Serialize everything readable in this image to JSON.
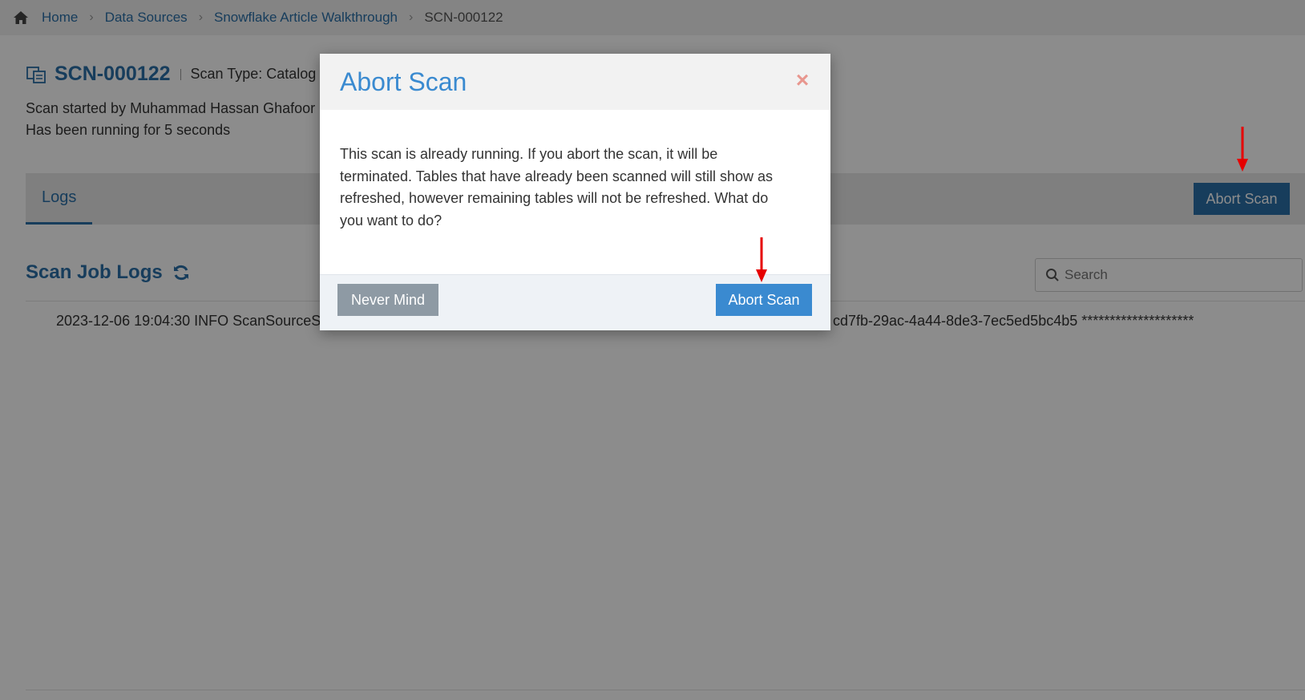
{
  "breadcrumb": {
    "home": "Home",
    "data_sources": "Data Sources",
    "walkthrough": "Snowflake Article Walkthrough",
    "current": "SCN-000122"
  },
  "scan": {
    "id": "SCN-000122",
    "type": "Scan Type: Catalog &",
    "started_by": "Scan started by Muhammad Hassan Ghafoor",
    "running": "Has been running for 5 seconds"
  },
  "tabs": {
    "logs": "Logs",
    "abort_label": "Abort Scan"
  },
  "logs": {
    "title": "Scan Job Logs",
    "search_placeholder": "Search",
    "line_left": "2023-12-06 19:04:30 INFO ScanSourceSe",
    "line_right": "cd7fb-29ac-4a44-8de3-7ec5ed5bc4b5 ********************"
  },
  "modal": {
    "title": "Abort Scan",
    "close": "×",
    "message": "This scan is already running. If you abort the scan, it will be terminated. Tables that have already been scanned will still show as refreshed, however remaining tables will not be refreshed. What do you want to do?",
    "never_mind": "Never Mind",
    "abort": "Abort Scan"
  },
  "colors": {
    "brand": "#2a6fa8",
    "modal_accent": "#3a8ad0",
    "annotation_arrow": "#e60000"
  },
  "icons": [
    "home-icon",
    "scan-icon",
    "refresh-icon",
    "search-icon",
    "close-icon",
    "arrow-down-icon"
  ]
}
